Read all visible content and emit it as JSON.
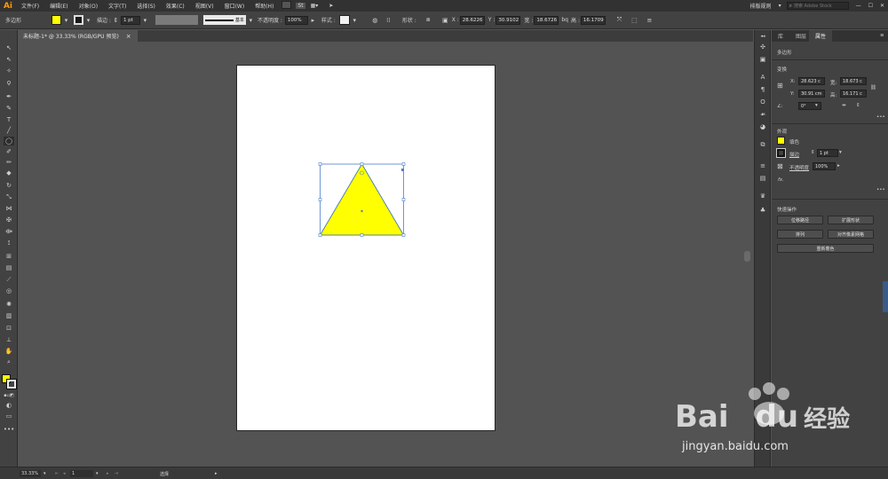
{
  "menubar": {
    "logo": "Ai",
    "items": [
      "文件(F)",
      "编辑(E)",
      "对象(O)",
      "文字(T)",
      "选择(S)",
      "效果(C)",
      "视图(V)",
      "窗口(W)",
      "帮助(H)"
    ],
    "st_label": "St",
    "workspace": "排版规则",
    "search_placeholder": "搜索 Adobe Stock"
  },
  "control": {
    "selection_label": "多边形",
    "stroke_label": "描边 :",
    "stroke_weight": "1 pt",
    "stroke_style": "基本",
    "opacity_label": "不透明度 :",
    "opacity": "100%",
    "style_label": "样式 :",
    "shape_label": "形状 :",
    "x_label": "X :",
    "x_value": "28.6226",
    "y_label": "Y :",
    "y_value": "30.9102",
    "w_label": "宽 :",
    "w_value": "18.6726",
    "h_label": "高 :",
    "h_value": "16.1709",
    "fill_color": "#ffff00",
    "stroke_color": "#000000"
  },
  "document": {
    "tab_title": "未标题-1* @ 33.33% (RGB/GPU 预览)",
    "close": "×"
  },
  "panel": {
    "tabs": [
      "库",
      "图层",
      "属性"
    ],
    "active_tab": "属性",
    "object_type": "多边形",
    "transform_title": "变换",
    "x_label": "X:",
    "x_value": "28.623 c",
    "y_label": "Y:",
    "y_value": "30.91 cm",
    "w_label": "宽:",
    "w_value": "18.673 c",
    "h_label": "高:",
    "h_value": "16.171 c",
    "angle_label": "∠:",
    "angle_value": "0°",
    "appearance_title": "外观",
    "fill_label": "填色",
    "stroke_label": "描边",
    "stroke_weight": "1 pt",
    "opacity_label": "不透明度",
    "opacity_value": "100%",
    "fx_label": "fx.",
    "quick_title": "快速操作",
    "btn_offset": "位移路径",
    "btn_expand": "扩展形状",
    "btn_arrange": "排列",
    "btn_pixel": "对齐像素网格",
    "btn_recolor": "重新着色"
  },
  "status": {
    "zoom": "33.33%",
    "artboard_num": "1",
    "tool": "选择"
  },
  "watermark": {
    "brand_a": "Bai",
    "brand_b": "du",
    "brand_cn": "经验",
    "url": "jingyan.baidu.com"
  },
  "colors": {
    "triangle": "#ffff00",
    "selection": "#4a7fc8",
    "accent": "#ff9a00"
  }
}
